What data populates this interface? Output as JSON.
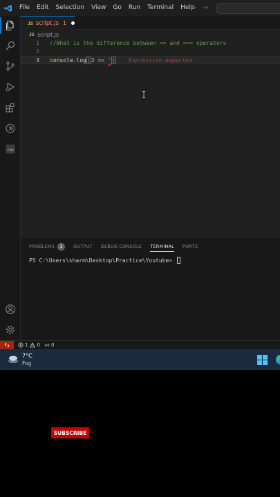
{
  "menubar": {
    "items": [
      "File",
      "Edit",
      "Selection",
      "View",
      "Go",
      "Run",
      "Terminal",
      "Help"
    ],
    "back_arrow": "←",
    "forward_arrow": "→"
  },
  "activity_bar": {
    "icons": [
      "files-icon",
      "search-icon",
      "source-control-icon",
      "run-debug-icon",
      "extensions-icon",
      "remote-icon",
      "env-icon",
      "account-icon",
      "settings-gear-icon"
    ],
    "env_label": ".ENV"
  },
  "tab": {
    "badge": "JS",
    "filename": "script.js",
    "problem_count": "1"
  },
  "breadcrumb": {
    "badge": "JS",
    "filename": "script.js"
  },
  "editor": {
    "lines": [
      {
        "number": "1",
        "comment": "//What is the difference between == and === operators"
      },
      {
        "number": "2"
      },
      {
        "number": "3",
        "ident": "console.log",
        "open_paren": "(",
        "num": "2",
        "op": " == ",
        "str": "'",
        "close_paren": ")"
      }
    ],
    "inline_error": "Expression expected."
  },
  "panel": {
    "tabs": [
      {
        "label": "PROBLEMS",
        "badge": "1"
      },
      {
        "label": "OUTPUT"
      },
      {
        "label": "DEBUG CONSOLE"
      },
      {
        "label": "TERMINAL",
        "active": true
      },
      {
        "label": "PORTS"
      }
    ],
    "terminal_prompt": "PS C:\\Users\\sharm\\Desktop\\Practice\\Youtube> "
  },
  "statusbar": {
    "errors": "1",
    "warnings": "0",
    "ports": "0"
  },
  "taskbar": {
    "temperature": "7°C",
    "weather": "Fog"
  },
  "overlay": {
    "subscribe_label": "SUBSCRIBE"
  },
  "colors": {
    "accent": "#0078d4",
    "error": "#f48771",
    "subscribe": "#cc0000"
  }
}
